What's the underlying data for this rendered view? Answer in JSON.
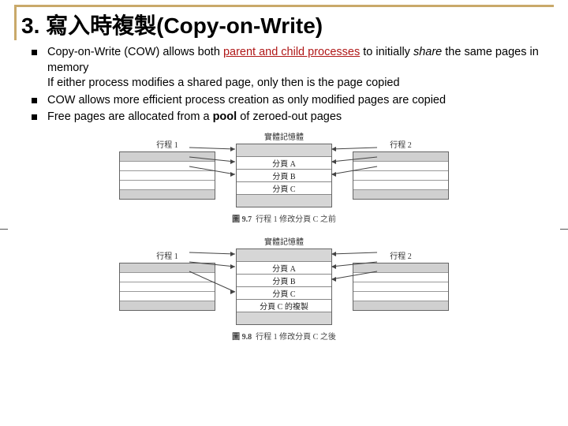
{
  "title": "3. 寫入時複製(Copy-on-Write)",
  "bullets": {
    "b1_a": "Copy-on-Write (COW) allows both ",
    "b1_hl": "parent and child processes",
    "b1_b": " to initially ",
    "b1_em": "share",
    "b1_c": " the same pages in memory",
    "b1_line2": "If either process modifies a shared page, only then is the page copied",
    "b2": "COW allows more efficient process creation as only modified pages are copied",
    "b3_a": "Free pages are allocated from a ",
    "b3_b": "pool",
    "b3_c": " of zeroed-out pages"
  },
  "diagram": {
    "proc1": "行程 1",
    "proc2": "行程 2",
    "mem": "實體記憶體",
    "pageA": "分頁 A",
    "pageB": "分頁 B",
    "pageC": "分頁 C",
    "copyC": "分頁 C 的複製"
  },
  "captions": {
    "fig1_no": "圖 9.7",
    "fig1_txt": "行程 1 修改分頁 C 之前",
    "fig2_no": "圖 9.8",
    "fig2_txt": "行程 1 修改分頁 C 之後"
  }
}
